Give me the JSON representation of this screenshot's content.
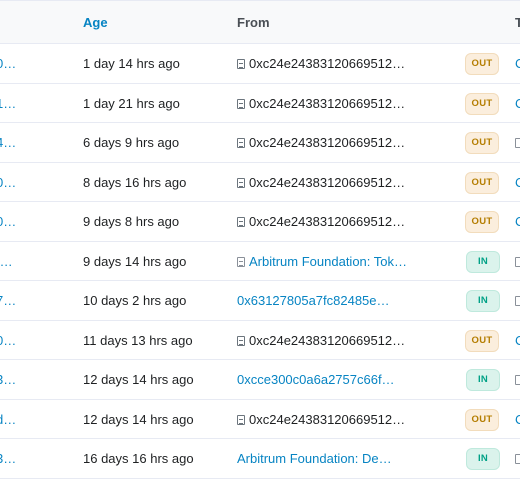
{
  "header": {
    "age": "Age",
    "from": "From",
    "to": "T"
  },
  "rows": [
    {
      "hash": "0…",
      "age": "1 day 14 hrs ago",
      "from": "0xc24e24383120669512…",
      "from_type": "contract",
      "direction": "OUT",
      "to": "C"
    },
    {
      "hash": "1…",
      "age": "1 day 21 hrs ago",
      "from": "0xc24e24383120669512…",
      "from_type": "contract",
      "direction": "OUT",
      "to": "C"
    },
    {
      "hash": "4…",
      "age": "6 days 9 hrs ago",
      "from": "0xc24e24383120669512…",
      "from_type": "contract",
      "direction": "OUT",
      "to": ""
    },
    {
      "hash": "0…",
      "age": "8 days 16 hrs ago",
      "from": "0xc24e24383120669512…",
      "from_type": "contract",
      "direction": "OUT",
      "to": "C"
    },
    {
      "hash": "0…",
      "age": "9 days 8 hrs ago",
      "from": "0xc24e24383120669512…",
      "from_type": "contract",
      "direction": "OUT",
      "to": "C"
    },
    {
      "hash": "f…",
      "age": "9 days 14 hrs ago",
      "from": "Arbitrum Foundation: Tok…",
      "from_type": "named-contract",
      "direction": "IN",
      "to": ""
    },
    {
      "hash": "7…",
      "age": "10 days 2 hrs ago",
      "from": "0x63127805a7fc82485e…",
      "from_type": "address",
      "direction": "IN",
      "to": ""
    },
    {
      "hash": "0…",
      "age": "11 days 13 hrs ago",
      "from": "0xc24e24383120669512…",
      "from_type": "contract",
      "direction": "OUT",
      "to": "C"
    },
    {
      "hash": "3…",
      "age": "12 days 14 hrs ago",
      "from": "0xcce300c0a6a2757c66f…",
      "from_type": "address",
      "direction": "IN",
      "to": ""
    },
    {
      "hash": "d…",
      "age": "12 days 14 hrs ago",
      "from": "0xc24e24383120669512…",
      "from_type": "contract",
      "direction": "OUT",
      "to": "C"
    },
    {
      "hash": "3…",
      "age": "16 days 16 hrs ago",
      "from": "Arbitrum Foundation: De…",
      "from_type": "named",
      "direction": "IN",
      "to": ""
    }
  ],
  "colors": {
    "link": "#0784c3",
    "out_bg": "#fbeedd",
    "out_text": "#b47d00",
    "in_bg": "#dbf3ec",
    "in_text": "#00a186"
  }
}
